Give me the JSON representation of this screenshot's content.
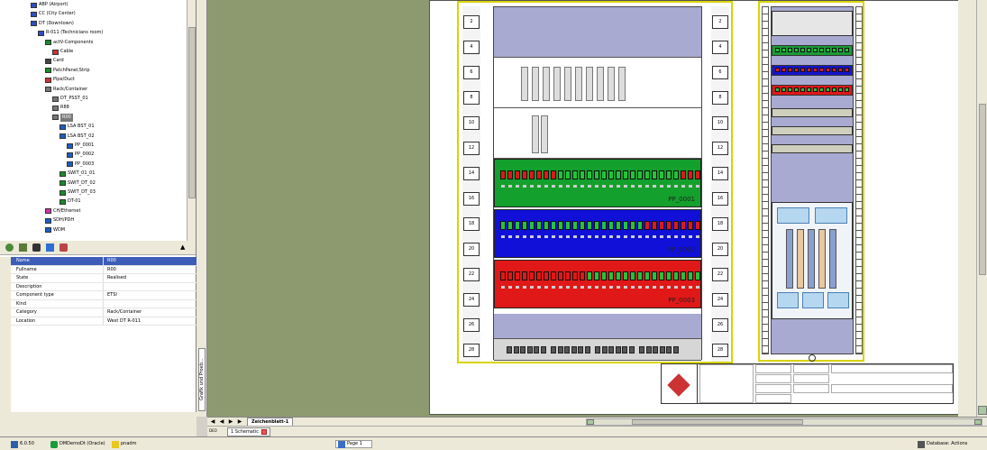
{
  "tree": {
    "items": [
      {
        "label": "ABP (Airport)",
        "depth": 3
      },
      {
        "label": "CC (City Center)",
        "depth": 3
      },
      {
        "label": "DT (Downtown)",
        "depth": 3
      },
      {
        "label": "R-011 (Technicians room)",
        "depth": 4
      },
      {
        "label": "actV-Components",
        "depth": 5
      },
      {
        "label": "Cable",
        "depth": 6
      },
      {
        "label": "Card",
        "depth": 5
      },
      {
        "label": "PatchPanel,Strip",
        "depth": 5
      },
      {
        "label": "Pipe/Duct",
        "depth": 5
      },
      {
        "label": "Rack/Container",
        "depth": 5
      },
      {
        "label": "DT_PSST_01",
        "depth": 6
      },
      {
        "label": "R88",
        "depth": 6
      },
      {
        "label": "R00",
        "depth": 6,
        "selected": true
      },
      {
        "label": "LSA BST_01",
        "depth": 7
      },
      {
        "label": "LSA BST_02",
        "depth": 7
      },
      {
        "label": "PP_0001",
        "depth": 8
      },
      {
        "label": "PP_0002",
        "depth": 8
      },
      {
        "label": "PP_0003",
        "depth": 8
      },
      {
        "label": "SWIT_01_01",
        "depth": 7
      },
      {
        "label": "SWIT_DT_02",
        "depth": 7
      },
      {
        "label": "SWIT_DT_03",
        "depth": 7
      },
      {
        "label": "DT-01",
        "depth": 7
      },
      {
        "label": "CH/Ethernet",
        "depth": 5
      },
      {
        "label": "SDH/PDH",
        "depth": 5
      },
      {
        "label": "WDM",
        "depth": 5
      }
    ]
  },
  "properties": {
    "rows": [
      {
        "name": "Name",
        "value": "R00",
        "selected": true
      },
      {
        "name": "Fullname",
        "value": "R00"
      },
      {
        "name": "State",
        "value": "Realised"
      },
      {
        "name": "Description",
        "value": ""
      },
      {
        "name": "Component type",
        "value": "ETSI"
      },
      {
        "name": "Kind",
        "value": ""
      },
      {
        "name": "Category",
        "value": "Rack/Container"
      },
      {
        "name": "Location",
        "value": "West DT R-011"
      }
    ]
  },
  "side_label": "Grafik und Proeb...",
  "rack1": {
    "units_left": [
      "2",
      "4",
      "6",
      "8",
      "10",
      "12",
      "14",
      "16",
      "18",
      "20",
      "22",
      "24",
      "26",
      "28"
    ],
    "units_right": [
      "2",
      "4",
      "6",
      "8",
      "10",
      "12",
      "14",
      "16",
      "18",
      "20",
      "22",
      "24",
      "26",
      "28"
    ],
    "panels": [
      {
        "label": "PP_0001",
        "color": "#14a02c"
      },
      {
        "label": "PP_0002",
        "color": "#1010d8"
      },
      {
        "label": "PP_0003",
        "color": "#e01818"
      }
    ]
  },
  "sheet_tab": "Zeichenblatt-1",
  "schematic": {
    "left_label": "DEO",
    "tab_label": "1 Schematic"
  },
  "statusbar": {
    "version": "6.0.50",
    "db": "DMDemoDt (Oracle)",
    "user": "pnadm",
    "task": "Page 1",
    "right": "Database: Actions"
  },
  "colors": {
    "canvas_bg": "#8d9a70",
    "selected_prop": "#3d5db8",
    "rack_border": "#d8d400"
  }
}
